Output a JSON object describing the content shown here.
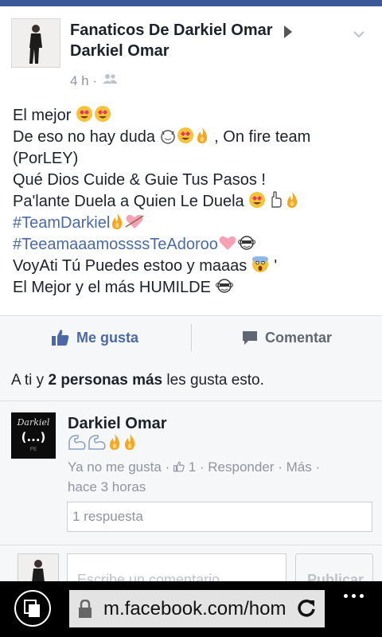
{
  "post": {
    "page_name": "Fanaticos De Darkiel Omar",
    "author_name": "Darkiel Omar",
    "time": "4 h ·",
    "lines": [
      "El mejor",
      "De eso no hay duda",
      ", On fire team",
      "(PorLEY)",
      "Qué Dios Cuide & Guie Tus Pasos !",
      "Pa'lante Duela a Quien Le Duela",
      "#TeamDarkiel",
      "#TeeamaaamossssTeAdoroo",
      "VoyAti Tú Puedes estoo y maaas",
      "'",
      "El Mejor y el más HUMILDE"
    ]
  },
  "actions": {
    "like_label": "Me gusta",
    "comment_label": "Comentar"
  },
  "likes": {
    "prefix": "A ti y",
    "bold": "2 personas más",
    "suffix": "les gusta esto."
  },
  "comment": {
    "author": "Darkiel Omar",
    "avatar_text": "Darkiel",
    "avatar_glyph": "(...)",
    "unlike": "Ya no me gusta",
    "like_count": "1",
    "reply": "Responder",
    "more": "Más",
    "time": "hace 3 horas",
    "replies": "1 respuesta"
  },
  "composer": {
    "placeholder": "Escribe un comentario...",
    "publish": "Publicar"
  },
  "browser": {
    "url": "m.facebook.com/hom"
  },
  "colors": {
    "brand": "#3b5998",
    "link": "#4b6aa5",
    "meta": "#90949c"
  },
  "icons": [
    "play-arrow-icon",
    "chevron-down-icon",
    "audience-friends-icon",
    "thumbs-up-icon",
    "comment-bubble-icon",
    "lock-icon",
    "refresh-icon",
    "tabs-icon",
    "more-dots-icon",
    "heart-eyes-emoji",
    "devil-emoji",
    "fire-emoji",
    "pointing-hand-emoji",
    "cupid-heart-emoji",
    "pink-heart-emoji",
    "monkey-emoji",
    "scream-emoji",
    "flexed-bicep-emoji"
  ]
}
